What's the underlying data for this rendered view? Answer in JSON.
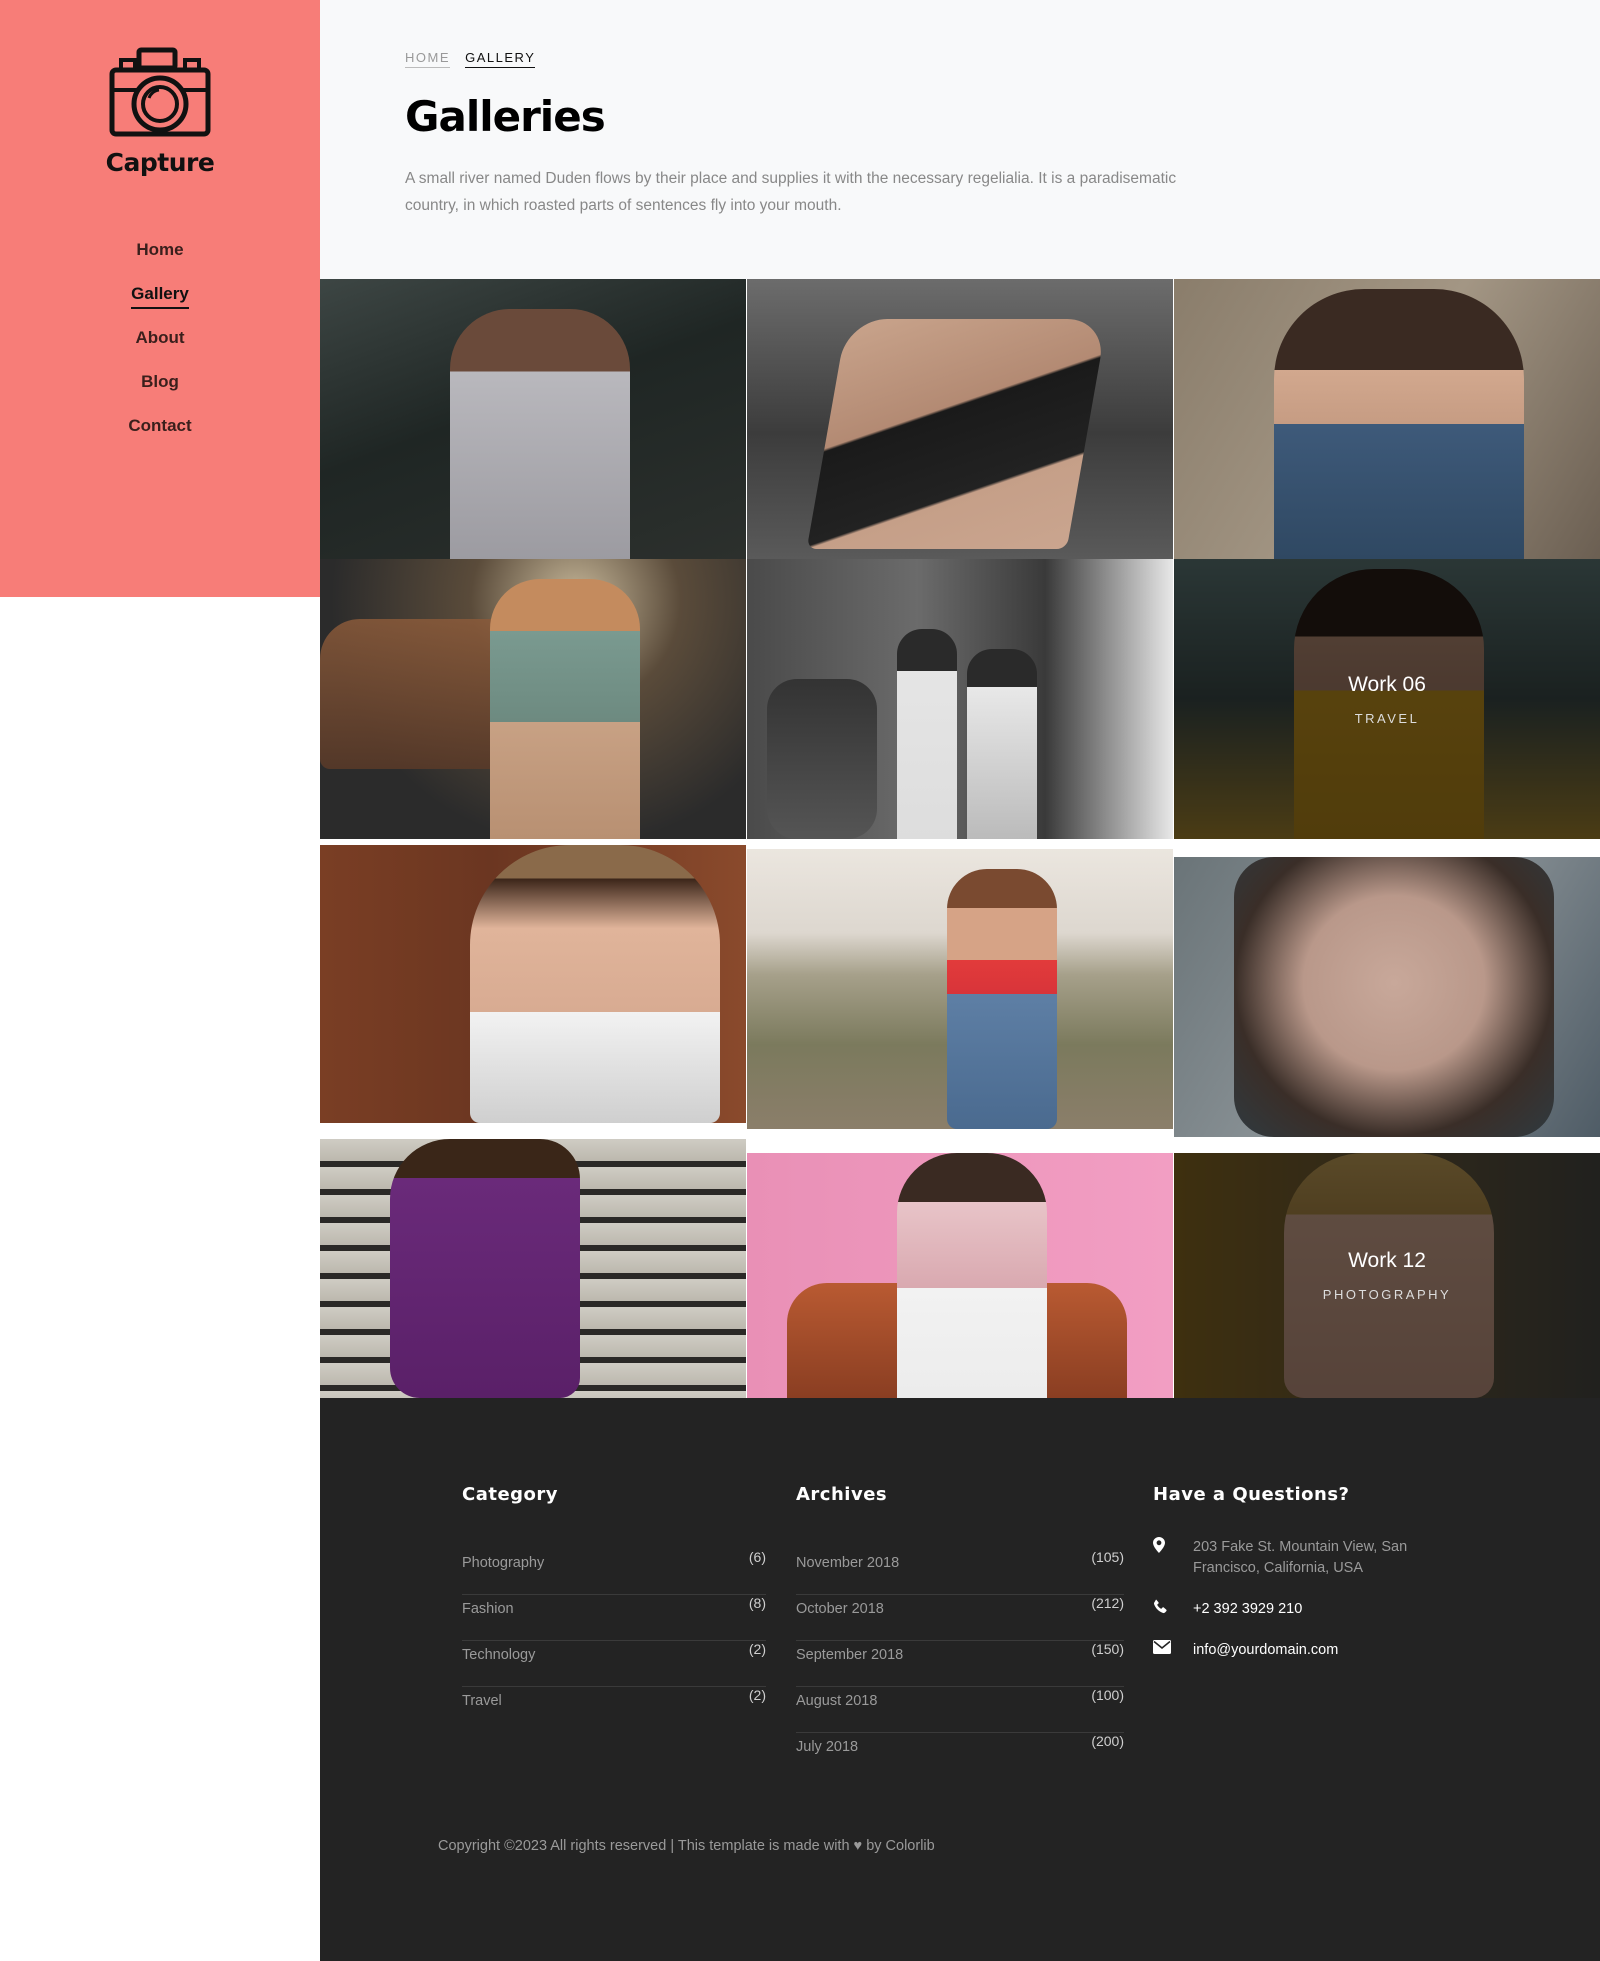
{
  "brand": {
    "name": "Capture",
    "icon": "camera-icon"
  },
  "nav": [
    {
      "label": "Home",
      "active": false
    },
    {
      "label": "Gallery",
      "active": true
    },
    {
      "label": "About",
      "active": false
    },
    {
      "label": "Blog",
      "active": false
    },
    {
      "label": "Contact",
      "active": false
    }
  ],
  "breadcrumb": {
    "home": "HOME",
    "current": "GALLERY"
  },
  "page": {
    "title": "Galleries",
    "intro": "A small river named Duden flows by their place and supplies it with the necessary regelialia. It is a paradisematic country, in which roasted parts of sentences fly into your mouth."
  },
  "gallery": {
    "work06": {
      "title": "Work 06",
      "category": "TRAVEL"
    },
    "work12": {
      "title": "Work 12",
      "category": "PHOTOGRAPHY"
    }
  },
  "footer": {
    "category": {
      "heading": "Category",
      "items": [
        {
          "label": "Photography",
          "count": "(6)"
        },
        {
          "label": "Fashion",
          "count": "(8)"
        },
        {
          "label": "Technology",
          "count": "(2)"
        },
        {
          "label": "Travel",
          "count": "(2)"
        }
      ]
    },
    "archives": {
      "heading": "Archives",
      "items": [
        {
          "label": "November 2018",
          "count": "(105)"
        },
        {
          "label": "October 2018",
          "count": "(212)"
        },
        {
          "label": "September 2018",
          "count": "(150)"
        },
        {
          "label": "August 2018",
          "count": "(100)"
        },
        {
          "label": "July 2018",
          "count": "(200)"
        }
      ]
    },
    "contact": {
      "heading": "Have a Questions?",
      "address": "203 Fake St. Mountain View, San Francisco, California, USA",
      "phone": "+2 392 3929 210",
      "email": "info@yourdomain.com"
    },
    "copyright_prefix": "Copyright ©2023 All rights reserved | This template is made with",
    "copyright_by": "by",
    "copyright_link": "Colorlib"
  },
  "colors": {
    "sidebar": "#f77d78",
    "footer": "#232323",
    "header_bg": "#f8f9fa"
  }
}
